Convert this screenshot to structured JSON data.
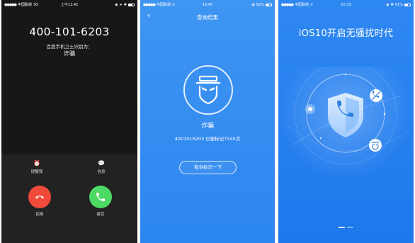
{
  "colors": {
    "dark_bg": "#171717",
    "blue_bg": "#2c86f0",
    "decline_red": "#f04a3a",
    "accept_green": "#4cd964"
  },
  "screens": [
    {
      "status": {
        "carrier": "中国联通",
        "network": "3G",
        "time": "上午11:42"
      },
      "incoming_call": {
        "number": "400-101-6203",
        "subtitle": "百度手机卫士识别为：",
        "tag": "诈骗"
      },
      "actions": [
        {
          "label": "提醒我",
          "icon": "alarm-clock-icon"
        },
        {
          "label": "信息",
          "icon": "message-icon"
        }
      ],
      "buttons": {
        "decline": "拒绝",
        "accept": "接受"
      }
    },
    {
      "status": {
        "carrier": "中国联通",
        "time": "16:45",
        "battery": "62%"
      },
      "nav": {
        "title": "查询结果",
        "back_icon": "chevron-left-icon"
      },
      "result": {
        "icon": "scam-face-icon",
        "title": "诈骗",
        "detail": "4001016203  已被标记7545次",
        "mark_button": "我也标记一下"
      }
    },
    {
      "status": {
        "carrier": "中国联通",
        "time": "10:33",
        "battery": "61%"
      },
      "promo": {
        "title": "iOS10开启无骚扰时代",
        "center_icon": "shield-phone-icon",
        "orbit_icons": [
          "phone-blocked-icon",
          "bell-icon",
          "scam-face-icon"
        ]
      },
      "pager": {
        "count": 2,
        "active": 0
      }
    }
  ]
}
